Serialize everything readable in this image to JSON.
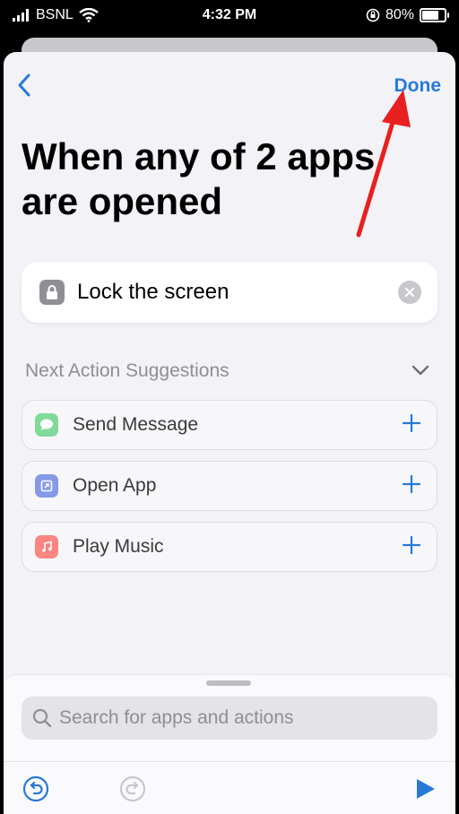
{
  "status_bar": {
    "carrier": "BSNL",
    "time": "4:32 PM",
    "battery": "80%",
    "battery_level": 0.8
  },
  "nav": {
    "done_label": "Done"
  },
  "title": "When any of 2 apps are opened",
  "action": {
    "label": "Lock the screen"
  },
  "suggestions": {
    "header": "Next Action Suggestions",
    "items": [
      {
        "label": "Send Message"
      },
      {
        "label": "Open App"
      },
      {
        "label": "Play Music"
      }
    ]
  },
  "search": {
    "placeholder": "Search for apps and actions"
  },
  "colors": {
    "accent": "#2779d7",
    "annotation_arrow": "#e8201f"
  },
  "icons": [
    "cellular-icon",
    "wifi-icon",
    "orientation-lock-icon",
    "battery-icon",
    "chevron-left-icon",
    "lock-icon",
    "clear-icon",
    "chevron-down-icon",
    "messages-icon",
    "open-app-icon",
    "music-icon",
    "plus-icon",
    "search-icon",
    "undo-icon",
    "redo-icon",
    "play-icon"
  ]
}
